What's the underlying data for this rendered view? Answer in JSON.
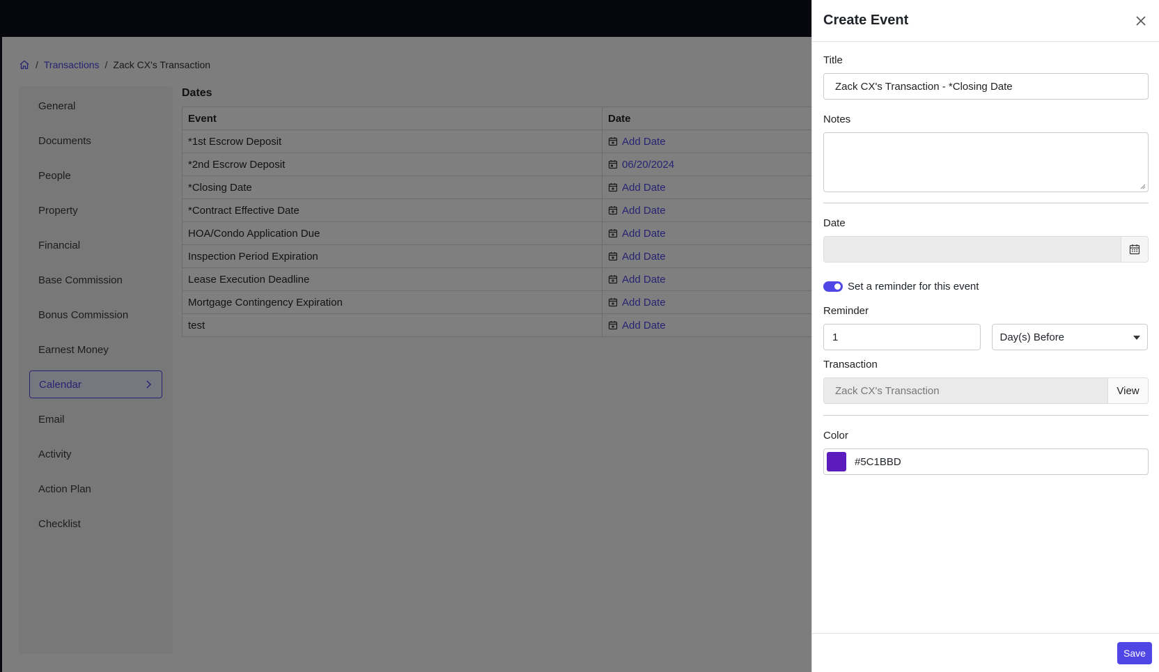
{
  "breadcrumb": {
    "home_icon": "home-icon",
    "items": [
      "Transactions",
      "Zack CX's Transaction"
    ]
  },
  "sidebar": {
    "items": [
      {
        "label": "General"
      },
      {
        "label": "Documents"
      },
      {
        "label": "People"
      },
      {
        "label": "Property"
      },
      {
        "label": "Financial"
      },
      {
        "label": "Base Commission"
      },
      {
        "label": "Bonus Commission"
      },
      {
        "label": "Earnest Money"
      },
      {
        "label": "Calendar",
        "active": true
      },
      {
        "label": "Email"
      },
      {
        "label": "Activity"
      },
      {
        "label": "Action Plan"
      },
      {
        "label": "Checklist"
      }
    ]
  },
  "dates": {
    "heading": "Dates",
    "columns": [
      "Event",
      "Date"
    ],
    "rows": [
      {
        "event": "*1st Escrow Deposit",
        "date": "Add Date"
      },
      {
        "event": "*2nd Escrow Deposit",
        "date": "06/20/2024"
      },
      {
        "event": "*Closing Date",
        "date": "Add Date"
      },
      {
        "event": "*Contract Effective Date",
        "date": "Add Date"
      },
      {
        "event": "HOA/Condo Application Due",
        "date": "Add Date"
      },
      {
        "event": "Inspection Period Expiration",
        "date": "Add Date"
      },
      {
        "event": "Lease Execution Deadline",
        "date": "Add Date"
      },
      {
        "event": "Mortgage Contingency Expiration",
        "date": "Add Date"
      },
      {
        "event": "test",
        "date": "Add Date"
      }
    ]
  },
  "drawer": {
    "title": "Create Event",
    "title_label": "Title",
    "title_value": "Zack CX's Transaction - *Closing Date",
    "notes_label": "Notes",
    "notes_value": "",
    "date_label": "Date",
    "date_value": "",
    "reminder_toggle_label": "Set a reminder for this event",
    "reminder_toggle_on": true,
    "reminder_label": "Reminder",
    "reminder_value": "1",
    "reminder_unit": "Day(s) Before",
    "transaction_label": "Transaction",
    "transaction_value": "Zack CX's Transaction",
    "view_label": "View",
    "color_label": "Color",
    "color_value": "#5C1BBD",
    "save_label": "Save"
  },
  "colors": {
    "accent": "#4f46e5",
    "event_color": "#5C1BBD"
  }
}
